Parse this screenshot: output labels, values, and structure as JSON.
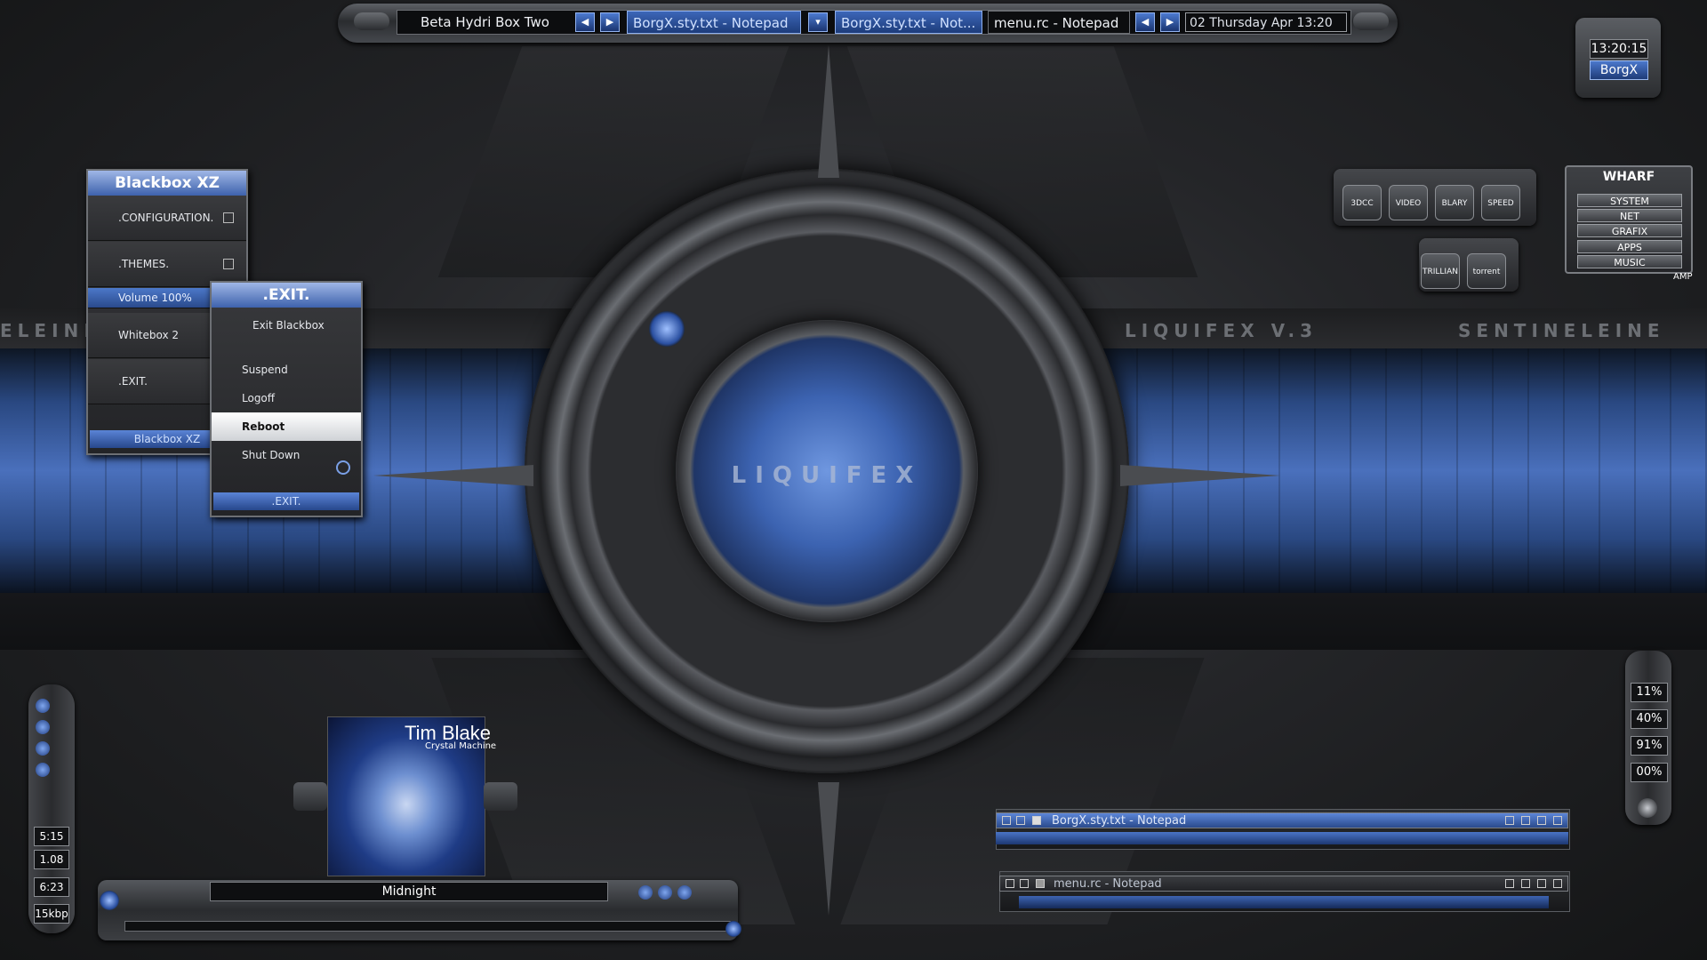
{
  "taskbar": {
    "workspace": "Beta Hydri Box Two",
    "tasks": [
      {
        "label": "BorgX.sty.txt - Notepad",
        "selected": true
      },
      {
        "label": "BorgX.sty.txt - Not...",
        "selected": true
      },
      {
        "label": "menu.rc - Notepad",
        "selected": false
      }
    ],
    "clock": "02 Thursday Apr 13:20"
  },
  "clock_widget": {
    "time": "13:20:15",
    "user": "BorgX"
  },
  "wallpaper": {
    "left_text": "ELEINE",
    "center_text": "LIQUIFEX V.3",
    "right_text": "SENTINELEINE",
    "logo": "LIQUIFEX"
  },
  "menu_main": {
    "title": "Blackbox XZ",
    "items": [
      {
        "label": ".CONFIGURATION.",
        "submenu": true
      },
      {
        "label": ".THEMES.",
        "submenu": true
      },
      {
        "label": "Volume 100%",
        "highlighted": true
      },
      {
        "label": "Whitebox 2"
      },
      {
        "label": ".EXIT."
      }
    ],
    "footer": "Blackbox XZ"
  },
  "menu_exit": {
    "title": ".EXIT.",
    "items": [
      {
        "label": "Exit  Blackbox"
      },
      {
        "label": "Suspend"
      },
      {
        "label": "Logoff"
      },
      {
        "label": "Reboot",
        "selected": true
      },
      {
        "label": "Shut Down"
      }
    ],
    "footer": ".EXIT."
  },
  "launcher": {
    "row1": [
      "3DCC",
      "VIDEO",
      "BLARY",
      "SPEED"
    ],
    "row2": [
      "TRILLIAN",
      "torrent"
    ]
  },
  "wharf": {
    "title": "WHARF",
    "items": [
      "SYSTEM",
      "NET",
      "GRAFIX",
      "APPS",
      "MUSIC"
    ],
    "footer": "AMP"
  },
  "left_stats": [
    "5:15",
    "1.08",
    "6:23",
    "15kbp"
  ],
  "media": {
    "artist": "Tim Blake",
    "album": "Crystal Machine",
    "track": "Midnight"
  },
  "gauges": [
    "11%",
    "40%",
    "91%",
    "00%"
  ],
  "windows": [
    {
      "title": "BorgX.sty.txt - Notepad",
      "active": true
    },
    {
      "title": "menu.rc - Notepad",
      "active": false
    }
  ],
  "colors": {
    "accent": "#3c66b8",
    "band": "#4c74c4",
    "panel": "#2a2b2e"
  }
}
